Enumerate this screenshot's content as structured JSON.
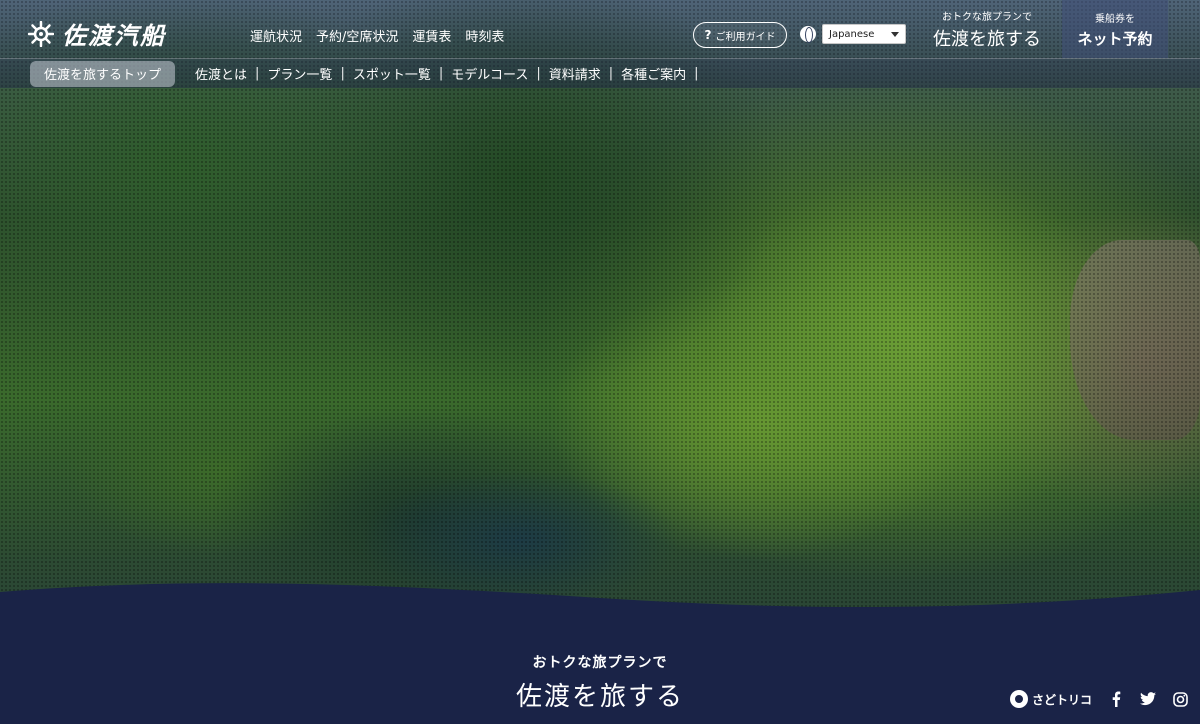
{
  "header": {
    "logo_text": "佐渡汽船",
    "nav": [
      {
        "label": "運航状況"
      },
      {
        "label": "予約/空席状況"
      },
      {
        "label": "運賃表"
      },
      {
        "label": "時刻表"
      }
    ],
    "guide_button": {
      "icon": "?",
      "label": "ご利用ガイド"
    },
    "language": {
      "selected": "Japanese"
    },
    "plan_button": {
      "small": "おトクな旅プランで",
      "large": "佐渡を旅する"
    },
    "ticket_button": {
      "small": "乗船券を",
      "large": "ネット予約"
    }
  },
  "subnav": {
    "active": "佐渡を旅するトップ",
    "items": [
      {
        "label": "佐渡とは"
      },
      {
        "label": "プラン一覧"
      },
      {
        "label": "スポット一覧"
      },
      {
        "label": "モデルコース"
      },
      {
        "label": "資料請求"
      },
      {
        "label": "各種ご案内"
      }
    ]
  },
  "promo": {
    "subtitle": "おトクな旅プランで",
    "title": "佐渡を旅する"
  },
  "social": {
    "brand": "さどトリコ",
    "icons": [
      "facebook-icon",
      "twitter-icon",
      "instagram-icon"
    ]
  },
  "colors": {
    "navy": "#1a2347",
    "white": "#ffffff"
  }
}
